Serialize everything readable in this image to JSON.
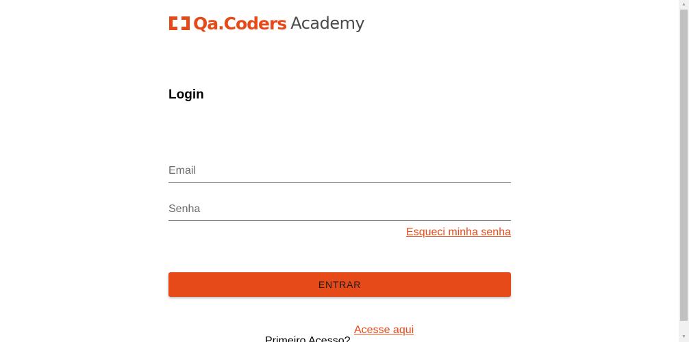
{
  "logo": {
    "brand": "Qa.Coders",
    "suffix": "Academy",
    "icon": "qa-coders-logo-icon"
  },
  "login": {
    "title": "Login",
    "email_placeholder": "Email",
    "password_placeholder": "Senha",
    "forgot_password": "Esqueci minha senha",
    "submit_label": "ENTRAR",
    "first_access_label": "Primeiro Acesso?",
    "first_access_link": "Acesse aqui"
  },
  "colors": {
    "accent": "#e64a19",
    "text": "#000000",
    "muted": "#6b6b6b"
  },
  "scrollbar": {
    "up_icon": "scroll-up-arrow-icon",
    "down_icon": "scroll-down-arrow-icon"
  }
}
